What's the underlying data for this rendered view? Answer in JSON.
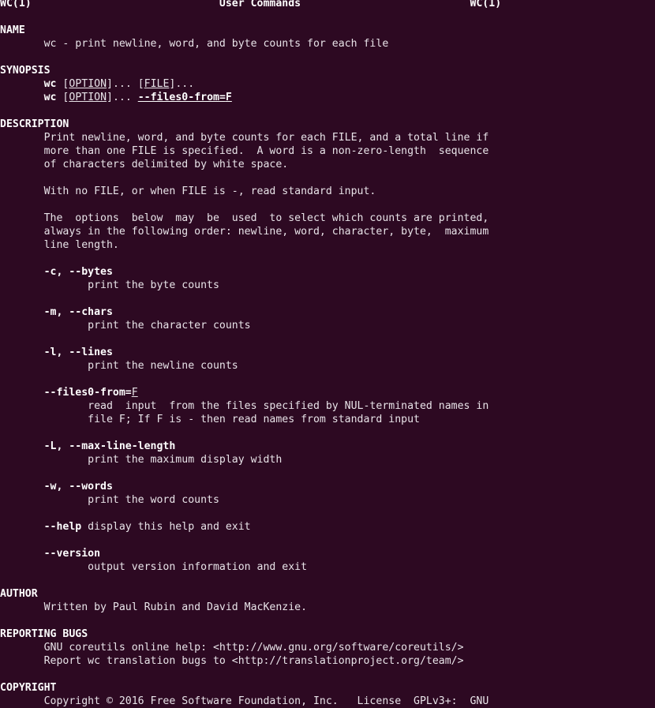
{
  "terminal": {
    "background_color": "#2d0922",
    "foreground_color": "#e8e3e8",
    "bold_color": "#ffffff",
    "columns": 80,
    "font_size_px": 13
  },
  "manpage": {
    "header": {
      "left": "WC(1)",
      "center": "User Commands",
      "right": "WC(1)"
    },
    "sections": {
      "name": {
        "heading": "NAME",
        "body": "wc - print newline, word, and byte counts for each file"
      },
      "synopsis": {
        "heading": "SYNOPSIS",
        "cmd": "wc",
        "option_token": "OPTION",
        "file_token": "FILE",
        "ellipsis": "]... [",
        "open_bracket": "[",
        "close_ellipsis": "]...",
        "files0_from": "--files0-from=",
        "files0_from_arg": "F"
      },
      "description": {
        "heading": "DESCRIPTION",
        "paragraph1_line1": "Print newline, word, and byte counts for each FILE, and a total line if",
        "paragraph1_line2": "more than one FILE is specified.  A word is a non-zero-length  sequence",
        "paragraph1_line3": "of characters delimited by white space.",
        "paragraph2_line1": "With no FILE, or when FILE is -, read standard input.",
        "paragraph3_line1": "The  options  below  may  be  used  to select which counts are printed,",
        "paragraph3_line2": "always in the following order: newline, word, character, byte,  maximum",
        "paragraph3_line3": "line length."
      },
      "options": [
        {
          "flag": "-c, --bytes",
          "desc_lines": [
            "print the byte counts"
          ]
        },
        {
          "flag": "-m, --chars",
          "desc_lines": [
            "print the character counts"
          ]
        },
        {
          "flag": "-l, --lines",
          "desc_lines": [
            "print the newline counts"
          ]
        },
        {
          "flag": "--files0-from=",
          "flag_arg": "F",
          "desc_lines": [
            "read  input  from the files specified by NUL-terminated names in",
            "file F; If F is - then read names from standard input"
          ]
        },
        {
          "flag": "-L, --max-line-length",
          "desc_lines": [
            "print the maximum display width"
          ]
        },
        {
          "flag": "-w, --words",
          "desc_lines": [
            "print the word counts"
          ]
        },
        {
          "flag": "--help",
          "inline_desc": " display this help and exit",
          "desc_lines": []
        },
        {
          "flag": "--version",
          "desc_lines": [
            "output version information and exit"
          ]
        }
      ],
      "author": {
        "heading": "AUTHOR",
        "body": "Written by Paul Rubin and David MacKenzie."
      },
      "reporting_bugs": {
        "heading": "REPORTING BUGS",
        "line1": "GNU coreutils online help: <http://www.gnu.org/software/coreutils/>",
        "line2": "Report wc translation bugs to <http://translationproject.org/team/>"
      },
      "copyright": {
        "heading": "COPYRIGHT",
        "line1": "Copyright © 2016 Free Software Foundation, Inc.   License  GPLv3+:  GNU"
      }
    }
  }
}
